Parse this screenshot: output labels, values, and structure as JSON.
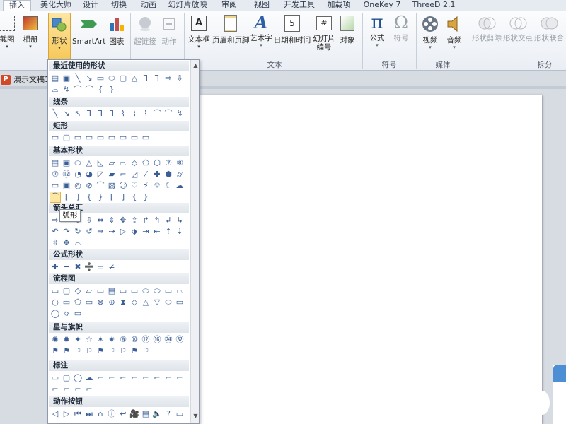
{
  "tabs": [
    "插入",
    "美化大师",
    "设计",
    "切换",
    "动画",
    "幻灯片放映",
    "审阅",
    "视图",
    "开发工具",
    "加载项",
    "OneKey 7",
    "ThreeD 2.1"
  ],
  "ribbon": {
    "screenshot": "截图",
    "album": "相册",
    "shapes": "形状",
    "smartart": "SmartArt",
    "chart": "图表",
    "hyperlink": "超链接",
    "action": "动作",
    "textbox": "文本框",
    "header_footer": "页眉和页脚",
    "wordart": "艺术字",
    "datetime": "日期和时间",
    "slide_number": "幻灯片\n编号",
    "object": "对象",
    "equation": "公式",
    "symbol": "符号",
    "video": "视频",
    "audio": "音频",
    "shape_cut": "形状剪除",
    "shape_intersect": "形状交点",
    "shape_union": "形状联合",
    "group_text": "文本",
    "group_symbols": "符号",
    "group_media": "媒体",
    "group_split": "拆分"
  },
  "document_name": "演示文稿1",
  "shapes_menu": {
    "sections": [
      {
        "title": "最近使用的形状",
        "rows": [
          [
            "▤",
            "▣",
            "╲",
            "↘",
            "▭",
            "⬭",
            "▢",
            "△",
            "⅂",
            "⅂",
            "⇨",
            "⇩"
          ],
          [
            "⌓",
            "↯",
            "⌒",
            "⌒",
            "{",
            "}"
          ]
        ]
      },
      {
        "title": "线条",
        "rows": [
          [
            "╲",
            "↘",
            "↖",
            "⅂",
            "⅂",
            "⅂",
            "⌇",
            "⌇",
            "⌇",
            "⌒",
            "⌒",
            "↯"
          ]
        ]
      },
      {
        "title": "矩形",
        "rows": [
          [
            "▭",
            "▢",
            "▭",
            "▭",
            "▭",
            "▭",
            "▭",
            "▭",
            "▭"
          ]
        ]
      },
      {
        "title": "基本形状",
        "rows": [
          [
            "▤",
            "▣",
            "⬭",
            "△",
            "◺",
            "▱",
            "⏢",
            "◇",
            "⬠",
            "⬡",
            "⑦",
            "⑧"
          ],
          [
            "⑩",
            "⑫",
            "◔",
            "◕",
            "◸",
            "▰",
            "⌐",
            "◿",
            "⁄",
            "✚",
            "⬢",
            "⌭"
          ],
          [
            "▭",
            "▣",
            "◎",
            "⊘",
            "⌒",
            "▨",
            "☺",
            "♡",
            "⚡",
            "☼",
            "☾",
            "☁"
          ],
          [
            "⌒",
            "[",
            "]",
            "{",
            "}",
            "[",
            "]",
            "{",
            "}"
          ]
        ]
      },
      {
        "title": "箭头总汇",
        "rows": [
          [
            "⇨",
            "⇦",
            "⇧",
            "⇩",
            "⇔",
            "⇕",
            "✥",
            "⇪",
            "↱",
            "↰",
            "↲",
            "↳"
          ],
          [
            "↶",
            "↷",
            "↻",
            "↺",
            "⇛",
            "⇢",
            "▷",
            "⬗",
            "⇥",
            "⇤",
            "⇡",
            "⇣"
          ],
          [
            "⇳",
            "✥",
            "⌓"
          ]
        ]
      },
      {
        "title": "公式形状",
        "rows": [
          [
            "✚",
            "━",
            "✖",
            "➗",
            "☰",
            "≠"
          ]
        ]
      },
      {
        "title": "流程图",
        "rows": [
          [
            "▭",
            "▢",
            "◇",
            "▱",
            "▭",
            "▤",
            "▭",
            "▭",
            "⬭",
            "⬭",
            "▭",
            "⏢"
          ],
          [
            "○",
            "▭",
            "⬠",
            "▭",
            "⊗",
            "⊕",
            "⧗",
            "◇",
            "△",
            "▽",
            "⬭",
            "▭"
          ],
          [
            "◯",
            "⌭",
            "▭"
          ]
        ]
      },
      {
        "title": "星与旗帜",
        "rows": [
          [
            "✺",
            "✹",
            "✦",
            "☆",
            "✶",
            "✷",
            "⑧",
            "⑩",
            "⑫",
            "⑯",
            "㉔",
            "㉜"
          ],
          [
            "⚑",
            "⚑",
            "⚐",
            "⚐",
            "⚑",
            "⚐",
            "⚐",
            "⚑",
            "⚐"
          ]
        ]
      },
      {
        "title": "标注",
        "rows": [
          [
            "▭",
            "▢",
            "◯",
            "☁",
            "⌐",
            "⌐",
            "⌐",
            "⌐",
            "⌐",
            "⌐",
            "⌐",
            "⌐"
          ],
          [
            "⌐",
            "⌐",
            "⌐",
            "⌐"
          ]
        ]
      },
      {
        "title": "动作按钮",
        "rows": [
          [
            "◁",
            "▷",
            "⏮",
            "⏭",
            "⌂",
            "ⓘ",
            "↩",
            "🎥",
            "▤",
            "🔈",
            "?",
            "▭"
          ]
        ]
      }
    ],
    "tooltip": "弧形"
  }
}
